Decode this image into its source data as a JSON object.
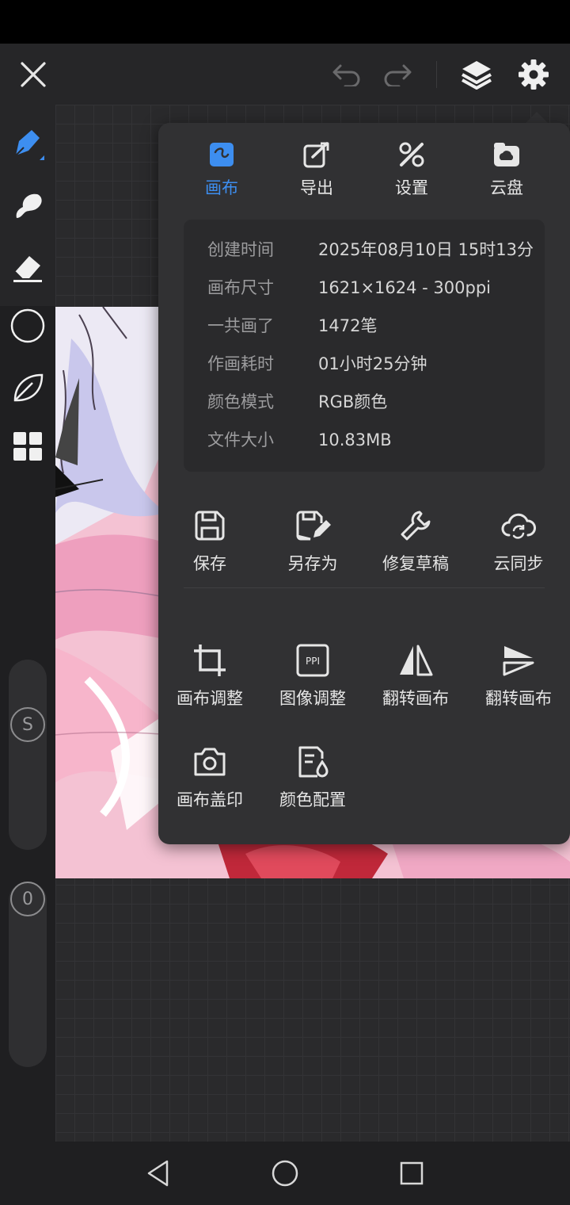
{
  "top_bar": {
    "close_icon": "close-icon",
    "undo_icon": "undo-icon",
    "redo_icon": "redo-icon",
    "layers_icon": "layers-icon",
    "settings_icon": "gear-icon"
  },
  "left_toolbar": {
    "tools": [
      "pen-icon",
      "smudge-icon",
      "eraser-icon",
      "circle-shape-icon",
      "leaf-icon",
      "grid-apps-icon"
    ],
    "size_label": "S",
    "opacity_label": "0",
    "accent": "#3d8ef0"
  },
  "popup": {
    "tabs": [
      {
        "label": "画布",
        "icon": "canvas-icon",
        "active": true
      },
      {
        "label": "导出",
        "icon": "export-icon",
        "active": false
      },
      {
        "label": "设置",
        "icon": "tools-icon",
        "active": false
      },
      {
        "label": "云盘",
        "icon": "cloud-drive-icon",
        "active": false
      }
    ],
    "info": [
      {
        "key": "创建时间",
        "value": "2025年08月10日 15时13分"
      },
      {
        "key": "画布尺寸",
        "value": "1621×1624 - 300ppi"
      },
      {
        "key": "一共画了",
        "value": "1472笔"
      },
      {
        "key": "作画耗时",
        "value": "01小时25分钟"
      },
      {
        "key": "颜色模式",
        "value": "RGB颜色"
      },
      {
        "key": "文件大小",
        "value": "10.83MB"
      }
    ],
    "actions_row1": [
      {
        "label": "保存",
        "icon": "save-icon"
      },
      {
        "label": "另存为",
        "icon": "save-as-icon"
      },
      {
        "label": "修复草稿",
        "icon": "wrench-icon"
      },
      {
        "label": "云同步",
        "icon": "cloud-sync-icon"
      }
    ],
    "actions_row2": [
      {
        "label": "画布调整",
        "icon": "crop-icon"
      },
      {
        "label": "图像调整",
        "icon": "ppi-icon"
      },
      {
        "label": "翻转画布",
        "icon": "flip-horizontal-icon"
      },
      {
        "label": "翻转画布",
        "icon": "flip-vertical-icon"
      }
    ],
    "actions_row3": [
      {
        "label": "画布盖印",
        "icon": "camera-icon"
      },
      {
        "label": "颜色配置",
        "icon": "color-profile-icon"
      }
    ],
    "ppi_text": "PPI"
  },
  "nav_bar": {
    "back_icon": "back-icon",
    "home_icon": "home-icon",
    "recents_icon": "recents-icon"
  }
}
